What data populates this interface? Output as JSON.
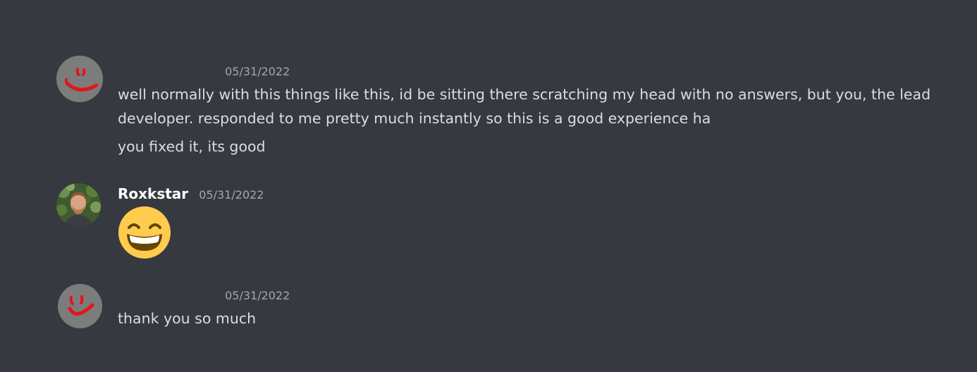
{
  "messages": [
    {
      "username": "",
      "timestamp": "05/31/2022",
      "avatar": "red-smiley-avatar",
      "lines": [
        "well normally with this things like this, id be sitting there scratching my head with no answers, but you, the lead",
        "developer. responded to me pretty much instantly so this is a good experience ha",
        "you fixed it, its good"
      ]
    },
    {
      "username": "Roxkstar",
      "timestamp": "05/31/2022",
      "avatar": "photo-avatar",
      "emoji": "grinning-face-with-smiling-eyes"
    },
    {
      "username": "",
      "timestamp": "05/31/2022",
      "avatar": "red-smiley-avatar",
      "lines": [
        "thank you so much"
      ]
    }
  ],
  "colors": {
    "background": "#36393f",
    "text": "#dcddde",
    "timestamp": "#a3a6aa",
    "username": "#ffffff"
  }
}
